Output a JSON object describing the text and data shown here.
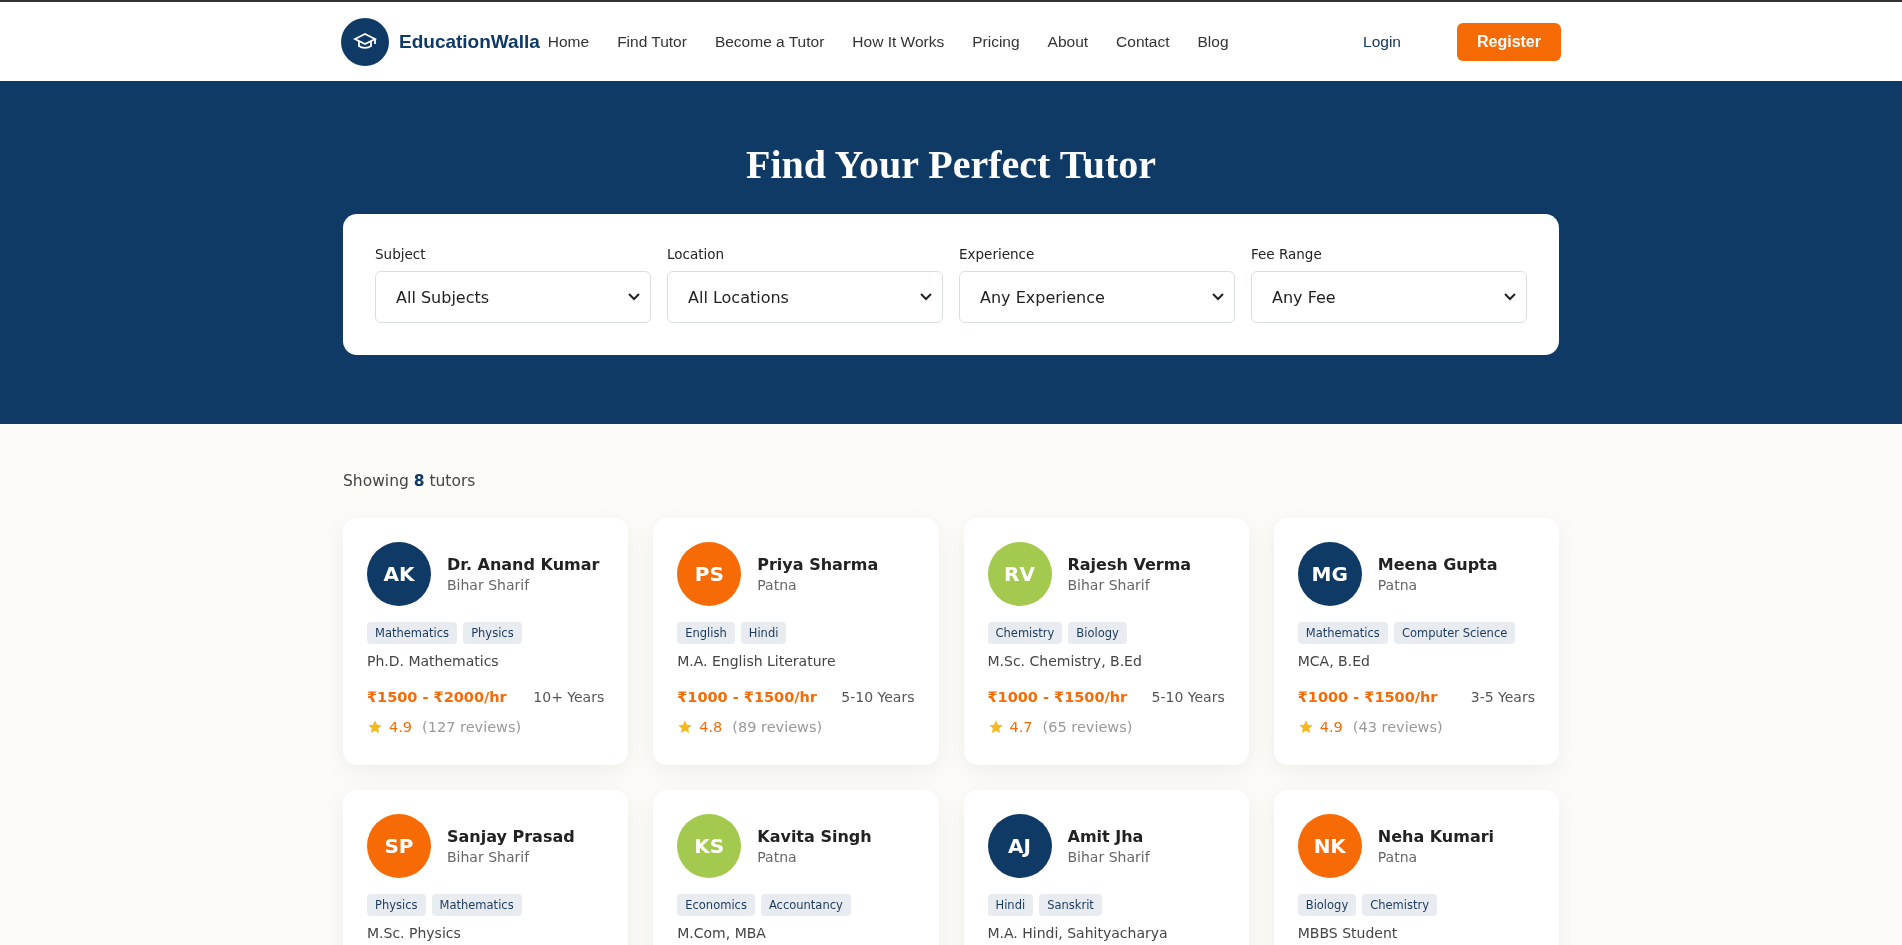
{
  "header": {
    "brand": "EducationWalla",
    "nav": [
      "Home",
      "Find Tutor",
      "Become a Tutor",
      "How It Works",
      "Pricing",
      "About",
      "Contact",
      "Blog"
    ],
    "login": "Login",
    "register": "Register"
  },
  "hero": {
    "title": "Find Your Perfect Tutor"
  },
  "filters": [
    {
      "label": "Subject",
      "value": "All Subjects"
    },
    {
      "label": "Location",
      "value": "All Locations"
    },
    {
      "label": "Experience",
      "value": "Any Experience"
    },
    {
      "label": "Fee Range",
      "value": "Any Fee"
    }
  ],
  "results": {
    "prefix": "Showing",
    "count": "8",
    "suffix": "tutors"
  },
  "tutors": [
    {
      "initials": "AK",
      "color": "#0f3a66",
      "name": "Dr. Anand Kumar",
      "location": "Bihar Sharif",
      "subjects": [
        "Mathematics",
        "Physics"
      ],
      "qualification": "Ph.D. Mathematics",
      "fee": "₹1500 - ₹2000/hr",
      "experience": "10+ Years",
      "rating": "4.9",
      "reviews": "(127 reviews)"
    },
    {
      "initials": "PS",
      "color": "#f76b07",
      "name": "Priya Sharma",
      "location": "Patna",
      "subjects": [
        "English",
        "Hindi"
      ],
      "qualification": "M.A. English Literature",
      "fee": "₹1000 - ₹1500/hr",
      "experience": "5-10 Years",
      "rating": "4.8",
      "reviews": "(89 reviews)"
    },
    {
      "initials": "RV",
      "color": "#a3c94e",
      "name": "Rajesh Verma",
      "location": "Bihar Sharif",
      "subjects": [
        "Chemistry",
        "Biology"
      ],
      "qualification": "M.Sc. Chemistry, B.Ed",
      "fee": "₹1000 - ₹1500/hr",
      "experience": "5-10 Years",
      "rating": "4.7",
      "reviews": "(65 reviews)"
    },
    {
      "initials": "MG",
      "color": "#0f3a66",
      "name": "Meena Gupta",
      "location": "Patna",
      "subjects": [
        "Mathematics",
        "Computer Science"
      ],
      "qualification": "MCA, B.Ed",
      "fee": "₹1000 - ₹1500/hr",
      "experience": "3-5 Years",
      "rating": "4.9",
      "reviews": "(43 reviews)"
    },
    {
      "initials": "SP",
      "color": "#f76b07",
      "name": "Sanjay Prasad",
      "location": "Bihar Sharif",
      "subjects": [
        "Physics",
        "Mathematics"
      ],
      "qualification": "M.Sc. Physics"
    },
    {
      "initials": "KS",
      "color": "#a3c94e",
      "name": "Kavita Singh",
      "location": "Patna",
      "subjects": [
        "Economics",
        "Accountancy"
      ],
      "qualification": "M.Com, MBA"
    },
    {
      "initials": "AJ",
      "color": "#0f3a66",
      "name": "Amit Jha",
      "location": "Bihar Sharif",
      "subjects": [
        "Hindi",
        "Sanskrit"
      ],
      "qualification": "M.A. Hindi, Sahityacharya"
    },
    {
      "initials": "NK",
      "color": "#f76b07",
      "name": "Neha Kumari",
      "location": "Patna",
      "subjects": [
        "Biology",
        "Chemistry"
      ],
      "qualification": "MBBS Student"
    }
  ]
}
